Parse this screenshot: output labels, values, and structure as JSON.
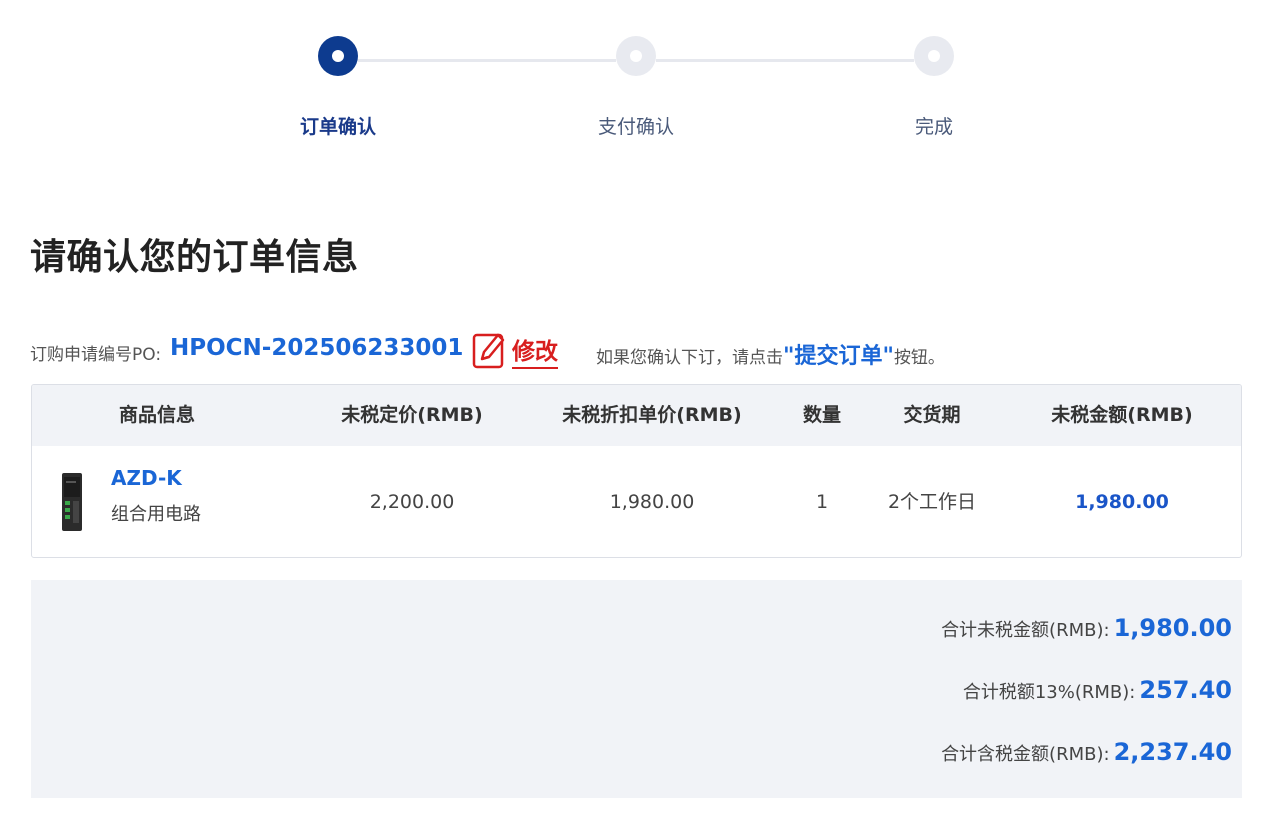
{
  "steps": [
    {
      "label": "订单确认",
      "active": true
    },
    {
      "label": "支付确认",
      "active": false
    },
    {
      "label": "完成",
      "active": false
    }
  ],
  "page_title": "请确认您的订单信息",
  "po": {
    "label": "订购申请编号PO:",
    "number": "HPOCN-202506233001",
    "edit_label": "修改",
    "hint_prefix": "如果您确认下订，请点击",
    "hint_button": "\"提交订单\"",
    "hint_suffix": "按钮。"
  },
  "table": {
    "headers": [
      "商品信息",
      "未税定价(RMB)",
      "未税折扣单价(RMB)",
      "数量",
      "交货期",
      "未税金额(RMB)"
    ],
    "rows": [
      {
        "product_name": "AZD-K",
        "product_desc": "组合用电路",
        "list_price": "2,200.00",
        "unit_price": "1,980.00",
        "quantity": "1",
        "delivery": "2个工作日",
        "amount": "1,980.00"
      }
    ]
  },
  "summary": {
    "subtotal_label": "合计未税金额(RMB):",
    "subtotal_value": "1,980.00",
    "tax_label": "合计税额13%(RMB):",
    "tax_value": "257.40",
    "total_label": "合计含税金额(RMB):",
    "total_value": "2,237.40"
  },
  "colors": {
    "accent_blue": "#1a66d6",
    "step_active": "#0d3b8f",
    "edit_red": "#d81e1e",
    "panel_bg": "#f1f3f7"
  },
  "icons": {
    "edit": "edit-icon",
    "product": "product-image"
  }
}
